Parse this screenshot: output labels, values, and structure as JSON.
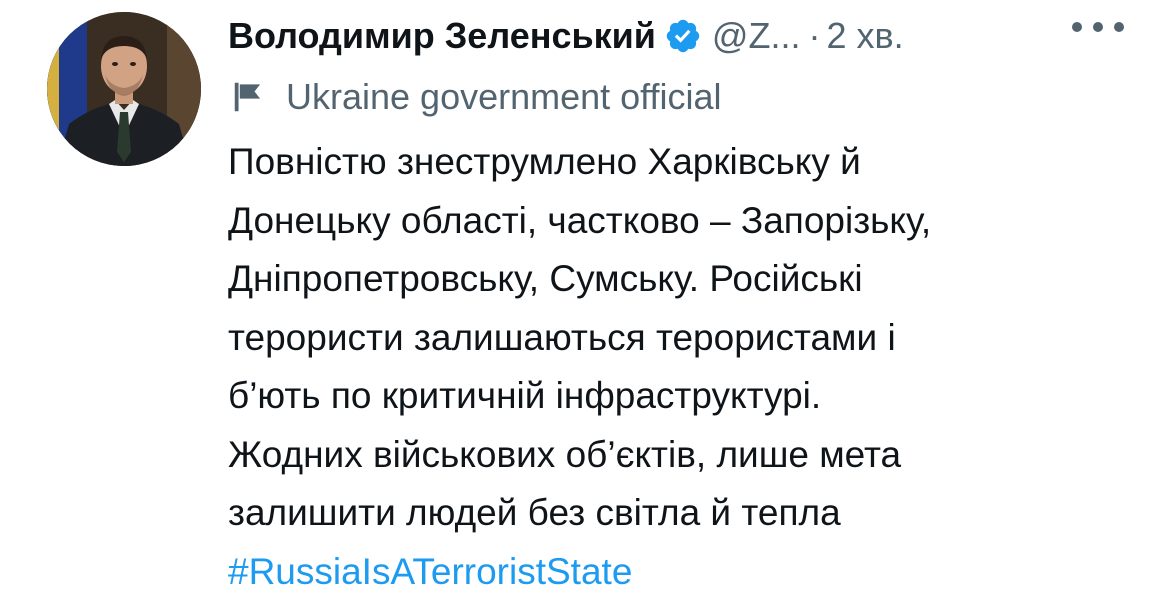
{
  "tweet": {
    "author": {
      "display_name": "Володимир Зеленський",
      "handle": "@Z...",
      "verified_icon": "verified-badge-icon",
      "verified_color": "#1d9bf0"
    },
    "separator": "·",
    "time": "2 хв.",
    "more_icon": "more-dots-icon",
    "label": {
      "icon": "flag-icon",
      "text": "Ukraine government official"
    },
    "body_lines": [
      "Повністю знеструмлено Харківську й",
      "Донецьку області, частково – Запорізьку,",
      "Дніпропетровську, Сумську. Російські",
      "терористи залишаються терористами і",
      "б’ють по критичній інфраструктурі.",
      "Жодних військових об’єктів, лише мета",
      "залишити людей без світла й тепла"
    ],
    "hashtag": "#RussiaIsATerroristState",
    "colors": {
      "text": "#0f1419",
      "secondary": "#536471",
      "link": "#1d9bf0"
    }
  }
}
